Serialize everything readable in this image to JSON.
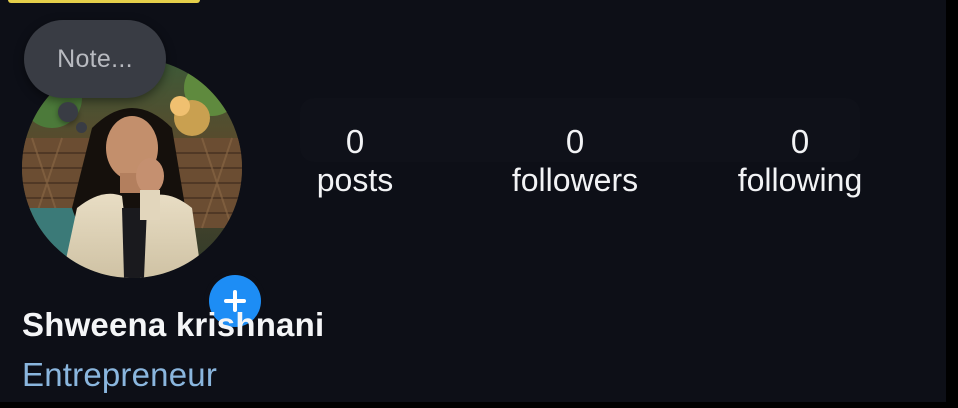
{
  "note": {
    "placeholder": "Note..."
  },
  "profile": {
    "avatar_icon": "profile-photo",
    "add_story_icon": "plus-icon",
    "name": "Shweena krishnani",
    "category": "Entrepreneur"
  },
  "stats": {
    "posts": {
      "value": "0",
      "label": "posts"
    },
    "followers": {
      "value": "0",
      "label": "followers"
    },
    "following": {
      "value": "0",
      "label": "following"
    }
  },
  "colors": {
    "background": "#0d0f17",
    "accent_blue": "#1d8df5",
    "category_text": "#8ab6de",
    "note_bubble": "#393c44"
  }
}
